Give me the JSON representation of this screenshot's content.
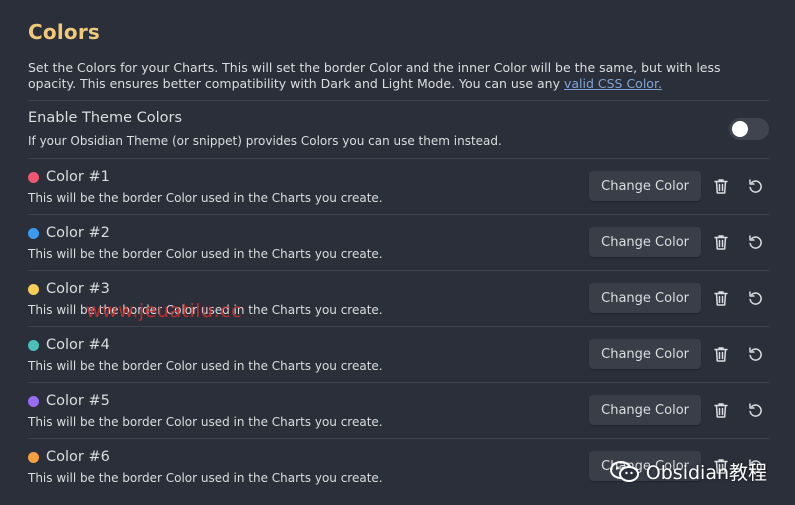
{
  "section": {
    "title": "Colors",
    "description_prefix": "Set the Colors for your Charts. This will set the border Color and the inner Color will be the same, but with less opacity. This ensures better compatibility with Dark and Light Mode. You can use any ",
    "description_link": "valid CSS Color.",
    "theme": {
      "title": "Enable Theme Colors",
      "subtitle": "If your Obsidian Theme (or snippet) provides Colors you can use them instead.",
      "enabled": false
    },
    "change_label": "Change Color",
    "colors": [
      {
        "title": "Color #1",
        "subtitle": "This will be the border Color used in the Charts you create.",
        "color": "#f0566f"
      },
      {
        "title": "Color #2",
        "subtitle": "This will be the border Color used in the Charts you create.",
        "color": "#3b9bf0"
      },
      {
        "title": "Color #3",
        "subtitle": "This will be the border Color used in the Charts you create.",
        "color": "#f6cd55"
      },
      {
        "title": "Color #4",
        "subtitle": "This will be the border Color used in the Charts you create.",
        "color": "#4bbfb8"
      },
      {
        "title": "Color #5",
        "subtitle": "This will be the border Color used in the Charts you create.",
        "color": "#9a6cf4"
      },
      {
        "title": "Color #6",
        "subtitle": "This will be the border Color used in the Charts you create.",
        "color": "#f5a040"
      }
    ]
  },
  "watermark": "www.jeuatilu.cc",
  "brand": "Obsidian教程",
  "accent": "#f0c87a",
  "link_color": "#7fa5d6"
}
